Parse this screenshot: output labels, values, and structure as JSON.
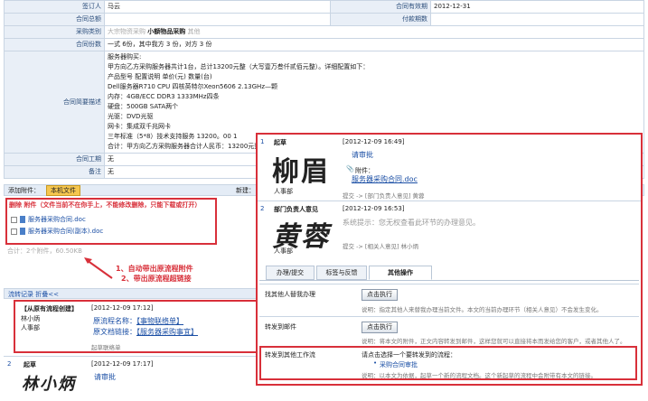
{
  "form": {
    "signer_label": "签订人",
    "signer": "马云",
    "valid_label": "合同有效期",
    "valid": "2012-12-31",
    "total_label": "合同总额",
    "paycount_label": "付款期数",
    "category_label": "采购类别",
    "category_opt1": "大宗物资采购",
    "category_selected": "小额物品采购",
    "category_opt3": "其他",
    "copies_label": "合同份数",
    "copies": "一式 6份，其中我方 3 份，对方 3 份",
    "desc_label": "合同简要描述",
    "desc_lines": [
      "服务器购买:",
      "甲方向乙方采购服务器共计1台，总计13200元整（大写壹万叁仟贰佰元整）。详细配置如下：",
      "产品型号 配置说明 单价(元) 数量(台)",
      "Dell服务器R710 CPU 四核英特尔Xeon5606 2.13GHz—颗",
      "内存：4GB/ECC DDR3 1333MHz四条",
      "硬盘：500GB SATA两个",
      "光驱：DVD光驱",
      "网卡：集成双千兆网卡",
      "三年标准（5*8）技术支持服务 13200。00 1",
      "合计：甲方向乙方采购服务器合计人民币：13200元整"
    ],
    "period_label": "合同工期",
    "period": "无",
    "remark_label": "备注",
    "remark": "无"
  },
  "attach": {
    "add_label": "添加附件：",
    "file_button": "本机文件",
    "new_label": "新建："
  },
  "attach_box": {
    "header": "删除 附件（文件当前不在你手上，不能修改删除，只能下载或打开）",
    "files": [
      "服务器采购合同.doc",
      "服务器采购合同(副本).doc"
    ]
  },
  "attach_total": "合计：2个附件，60.50KB",
  "annotation": {
    "line1": "1、自动带出原流程附件",
    "line2": "2、带出原流程超链接"
  },
  "flow_bar": "流转记录 折叠<<",
  "origin": {
    "title": "【从原有流程创建】",
    "date": "[2012-12-09 17:12]",
    "user": "林小炳",
    "dept": "人事部",
    "name_label": "原流程名称：",
    "name_value": "【事物联络单】",
    "doc_label": "原文档链接：",
    "doc_value": "【服务器采购事宜】",
    "footer": "起草联络单"
  },
  "step2": {
    "num": "2",
    "title": "起草",
    "date": "[2012-12-09 17:17]",
    "action": "请审批",
    "signature": "林小炳"
  },
  "popup": {
    "r1": {
      "num": "1",
      "title": "起草",
      "date": "[2012-12-09 16:49]",
      "signature": "柳眉",
      "action": "请审批",
      "attach_label": "附件：",
      "attach_file": "服务器采购合同.doc",
      "dept": "人事部",
      "submit": "提交 -> [部门负责人意见] 黄蓉"
    },
    "r2": {
      "num": "2",
      "title": "部门负责人意见",
      "date": "[2012-12-09 16:53]",
      "signature": "黄蓉",
      "hint": "系统提示：您无权查看此环节的办理意见。",
      "dept": "人事部",
      "submit": "提交 -> [相关人意见] 林小炳"
    },
    "tabs": [
      "办理/提交",
      "标签与反馈",
      "其他操作"
    ],
    "ops": [
      {
        "label": "找其他人替我办理",
        "button": "点击执行",
        "note": "说明：指定其他人来替我办理当前文件。本文的当前办理环节（相关人意见）不会发生变化。"
      },
      {
        "label": "转发到邮件",
        "button": "点击执行",
        "note": "说明：将本文的附件，正文内容转发到邮件，这样您就可以直接将本而发给您的客户，或者其他人了。"
      },
      {
        "label": "转发到其他工作流",
        "prompt": "请点击选择一个要转发到的流程：",
        "link": "采购合同审批",
        "note": "说明：以本文为依据，起草一个新的流程文档。这个新起草的流程中会附带有本文的链接。"
      }
    ]
  },
  "colors": {
    "accent": "#d8303a",
    "label_bg": "#e9eff7",
    "link": "#1b4fa5"
  }
}
